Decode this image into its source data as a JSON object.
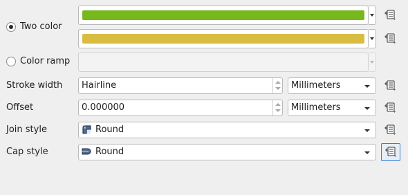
{
  "two_color": {
    "label": "Two color",
    "checked": true,
    "color1": "#77b81c",
    "color2": "#d8bd41"
  },
  "color_ramp": {
    "label": "Color ramp",
    "checked": false
  },
  "stroke_width": {
    "label": "Stroke width",
    "value": "Hairline",
    "unit": "Millimeters"
  },
  "offset": {
    "label": "Offset",
    "value": "0.000000",
    "unit": "Millimeters"
  },
  "join_style": {
    "label": "Join style",
    "value": "Round",
    "icon": "round-join-icon"
  },
  "cap_style": {
    "label": "Cap style",
    "value": "Round",
    "icon": "round-cap-icon"
  },
  "colors": {
    "accent_focus": "#3a7ecf"
  }
}
